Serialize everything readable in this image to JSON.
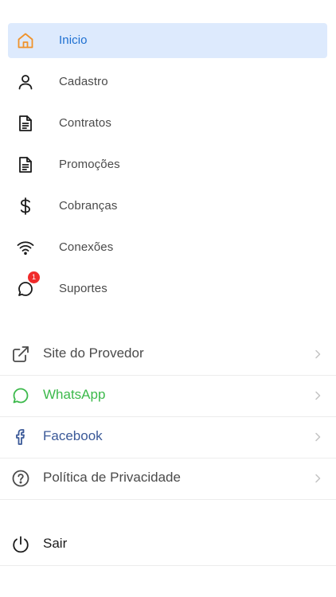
{
  "colors": {
    "active_bg": "#ddeafd",
    "active_text": "#1d6fd1",
    "home_icon": "#f0932b",
    "whatsapp": "#3cb94b",
    "facebook": "#3b5998",
    "badge": "#f02a2a",
    "text": "#4a4a4a"
  },
  "nav": {
    "items": [
      {
        "label": "Inicio",
        "icon": "home-icon",
        "active": true
      },
      {
        "label": "Cadastro",
        "icon": "user-icon"
      },
      {
        "label": "Contratos",
        "icon": "document-icon"
      },
      {
        "label": "Promoções",
        "icon": "document-icon"
      },
      {
        "label": "Cobranças",
        "icon": "dollar-icon"
      },
      {
        "label": "Conexões",
        "icon": "wifi-icon"
      },
      {
        "label": "Suportes",
        "icon": "chat-icon",
        "badge": "1"
      }
    ]
  },
  "links": {
    "items": [
      {
        "label": "Site do Provedor",
        "icon": "external-link-icon"
      },
      {
        "label": "WhatsApp",
        "icon": "whatsapp-icon"
      },
      {
        "label": "Facebook",
        "icon": "facebook-icon"
      },
      {
        "label": "Política de Privacidade",
        "icon": "help-circle-icon"
      }
    ]
  },
  "logout": {
    "label": "Sair",
    "icon": "power-icon"
  }
}
